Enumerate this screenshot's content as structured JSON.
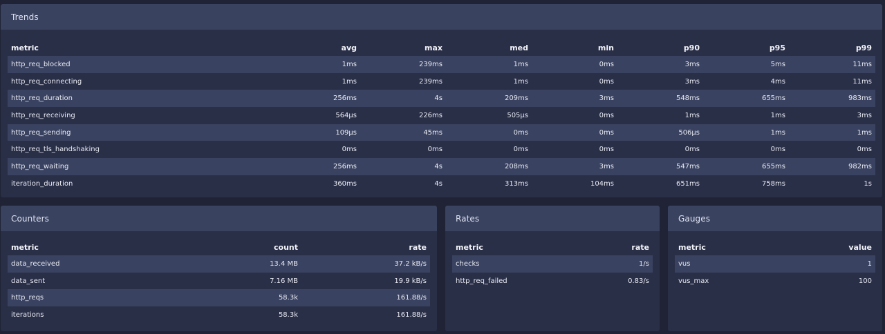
{
  "trends": {
    "title": "Trends",
    "columns": [
      "metric",
      "avg",
      "max",
      "med",
      "min",
      "p90",
      "p95",
      "p99"
    ],
    "rows": [
      [
        "http_req_blocked",
        "1ms",
        "239ms",
        "1ms",
        "0ms",
        "3ms",
        "5ms",
        "11ms"
      ],
      [
        "http_req_connecting",
        "1ms",
        "239ms",
        "1ms",
        "0ms",
        "3ms",
        "4ms",
        "11ms"
      ],
      [
        "http_req_duration",
        "256ms",
        "4s",
        "209ms",
        "3ms",
        "548ms",
        "655ms",
        "983ms"
      ],
      [
        "http_req_receiving",
        "564µs",
        "226ms",
        "505µs",
        "0ms",
        "1ms",
        "1ms",
        "3ms"
      ],
      [
        "http_req_sending",
        "109µs",
        "45ms",
        "0ms",
        "0ms",
        "506µs",
        "1ms",
        "1ms"
      ],
      [
        "http_req_tls_handshaking",
        "0ms",
        "0ms",
        "0ms",
        "0ms",
        "0ms",
        "0ms",
        "0ms"
      ],
      [
        "http_req_waiting",
        "256ms",
        "4s",
        "208ms",
        "3ms",
        "547ms",
        "655ms",
        "982ms"
      ],
      [
        "iteration_duration",
        "360ms",
        "4s",
        "313ms",
        "104ms",
        "651ms",
        "758ms",
        "1s"
      ]
    ]
  },
  "counters": {
    "title": "Counters",
    "columns": [
      "metric",
      "count",
      "rate"
    ],
    "rows": [
      [
        "data_received",
        "13.4 MB",
        "37.2 kB/s"
      ],
      [
        "data_sent",
        "7.16 MB",
        "19.9 kB/s"
      ],
      [
        "http_reqs",
        "58.3k",
        "161.88/s"
      ],
      [
        "iterations",
        "58.3k",
        "161.88/s"
      ]
    ]
  },
  "rates": {
    "title": "Rates",
    "columns": [
      "metric",
      "rate"
    ],
    "rows": [
      [
        "checks",
        "1/s"
      ],
      [
        "http_req_failed",
        "0.83/s"
      ]
    ]
  },
  "gauges": {
    "title": "Gauges",
    "columns": [
      "metric",
      "value"
    ],
    "rows": [
      [
        "vus",
        "1"
      ],
      [
        "vus_max",
        "100"
      ]
    ]
  }
}
